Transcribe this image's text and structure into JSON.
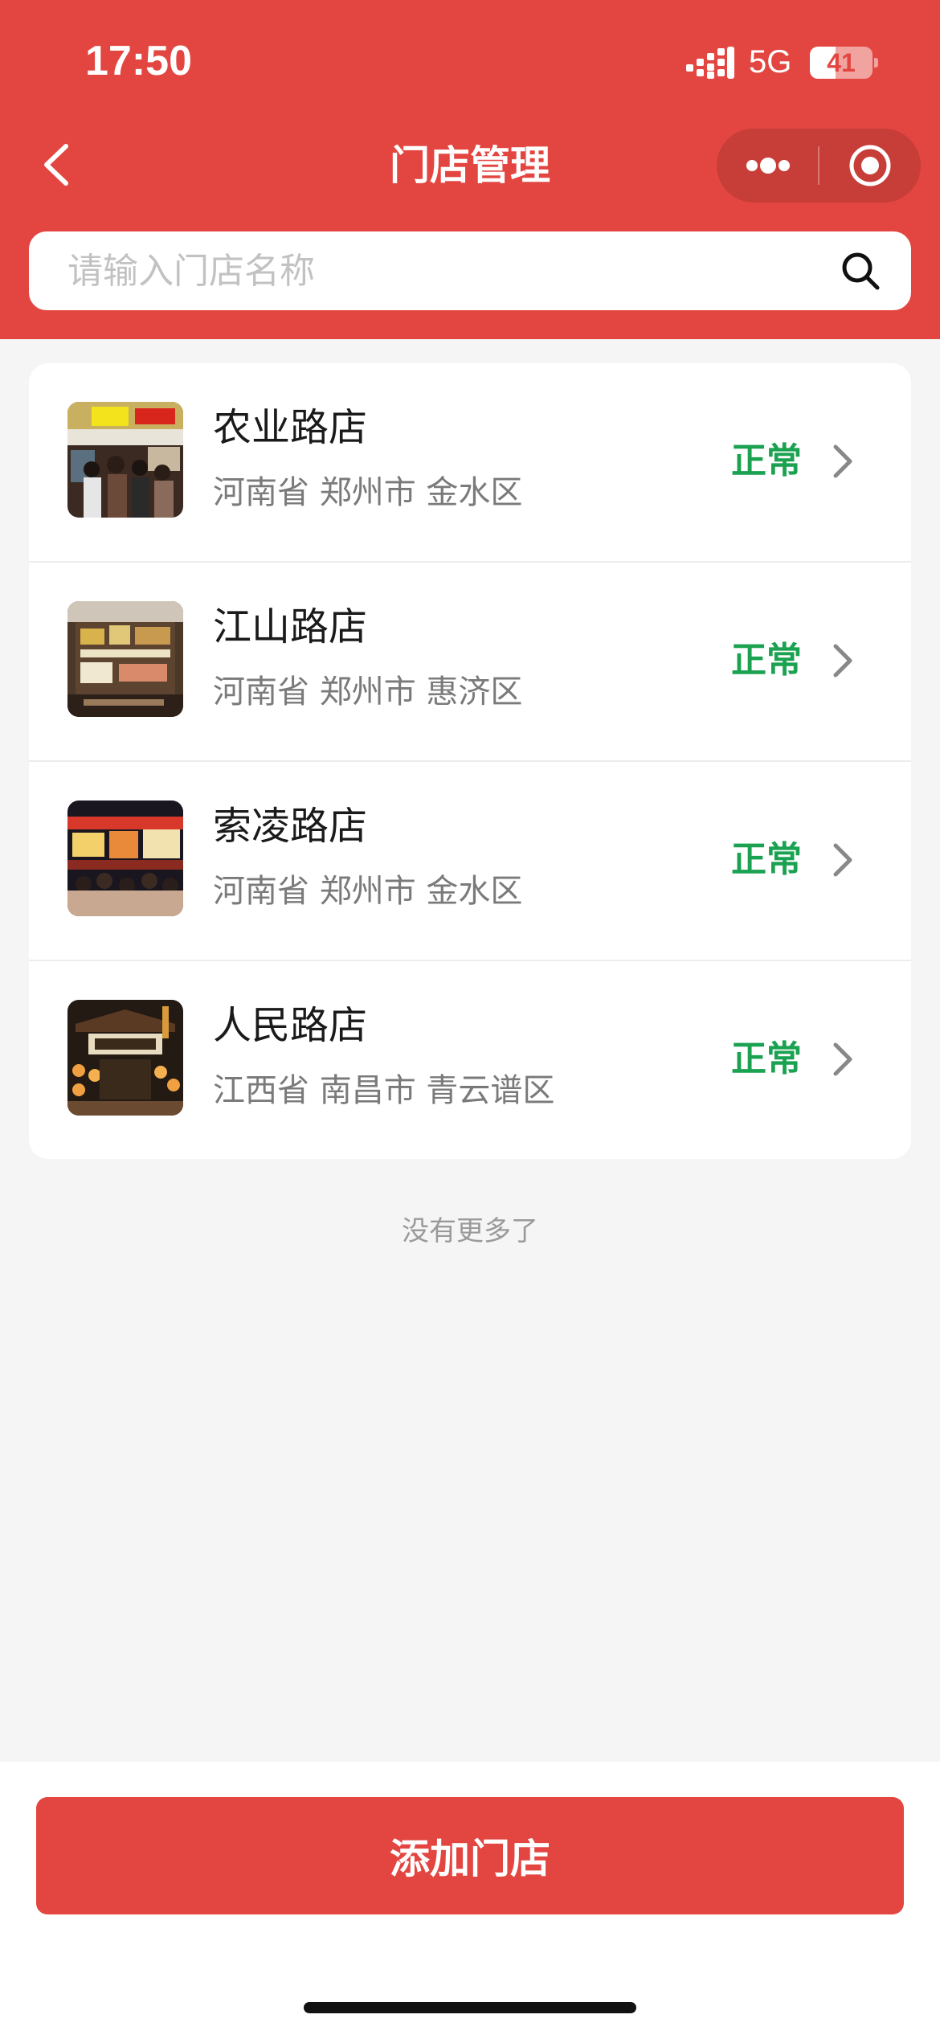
{
  "status_bar": {
    "time": "17:50",
    "network": "5G",
    "battery": "41",
    "battery_level": 0.41
  },
  "header": {
    "title": "门店管理"
  },
  "search": {
    "placeholder": "请输入门店名称"
  },
  "stores": [
    {
      "name": "农业路店",
      "address": "河南省 郑州市 金水区",
      "status": "正常",
      "thumb": "food-street-photo"
    },
    {
      "name": "江山路店",
      "address": "河南省 郑州市 惠济区",
      "status": "正常",
      "thumb": "shop-shelves-photo"
    },
    {
      "name": "索凌路店",
      "address": "河南省 郑州市 金水区",
      "status": "正常",
      "thumb": "night-market-photo"
    },
    {
      "name": "人民路店",
      "address": "江西省 南昌市 青云谱区",
      "status": "正常",
      "thumb": "lantern-gate-photo"
    }
  ],
  "list_end_text": "没有更多了",
  "footer": {
    "add_button_label": "添加门店"
  },
  "colors": {
    "brand_red": "#e34640",
    "status_green": "#1aa251"
  }
}
